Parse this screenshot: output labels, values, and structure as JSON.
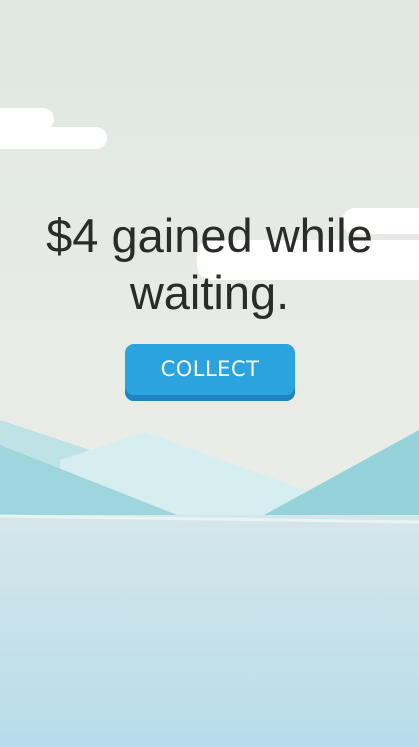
{
  "game": {
    "message": "$4 gained while waiting.",
    "collect_label": "COLLECT"
  },
  "colors": {
    "button": "#2aa3de",
    "button_shadow": "#1f83bd",
    "text": "#2b2b2b",
    "water_top": "#d3e6ea",
    "water_bottom": "#b8dcea",
    "mountains": "#9fd6de"
  }
}
